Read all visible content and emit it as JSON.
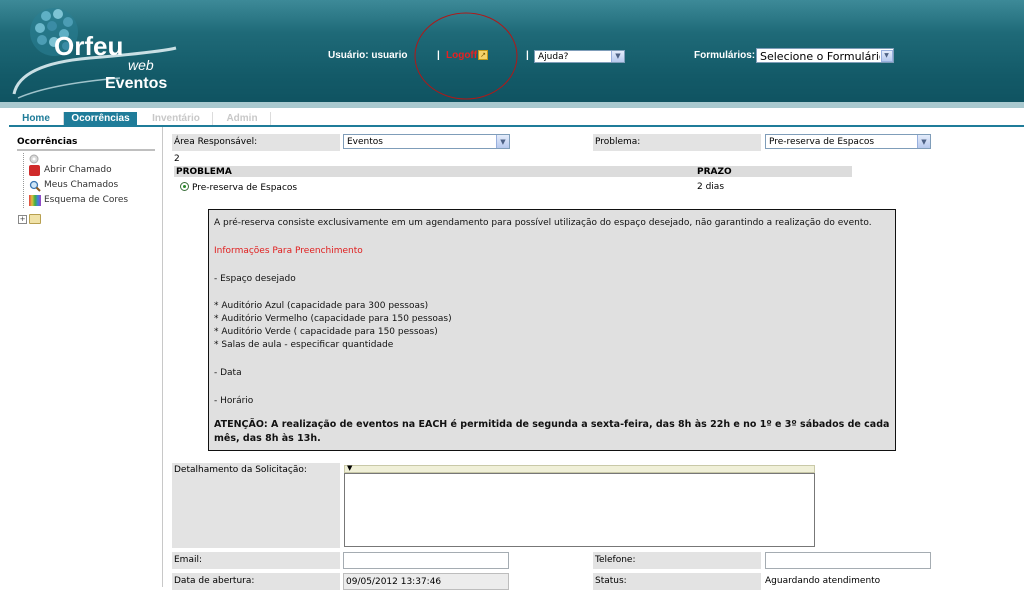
{
  "header": {
    "logo_main": "Orfeu",
    "logo_sub": "web",
    "logo_module": "Eventos",
    "user_label": "Usuário: usuario",
    "sep1": "|",
    "logoff_label": "Logoff",
    "sep2": "|",
    "help_select": "Ajuda?",
    "forms_label": "Formulários:",
    "forms_select": "Selecione o Formulário"
  },
  "tabs": [
    "Home",
    "Ocorrências",
    "Inventário",
    "Admin"
  ],
  "sidebar": {
    "title": "Ocorrências",
    "items": [
      "Abrir Chamado",
      "Meus Chamados",
      "Esquema de Cores"
    ]
  },
  "form": {
    "area_label": "Área Responsável:",
    "area_value": "Eventos",
    "problem_label": "Problema:",
    "problem_value": "Pre-reserva de Espacos",
    "count": "2",
    "col_problem": "PROBLEMA",
    "col_prazo": "PRAZO",
    "row_problem": "Pre-reserva de Espacos",
    "row_prazo": "2 dias",
    "detail_label": "Detalhamento da Solicitação:",
    "email_label": "Email:",
    "phone_label": "Telefone:",
    "opened_label": "Data de abertura:",
    "opened_value": "09/05/2012 13:37:46",
    "status_label": "Status:",
    "status_value": "Aguardando atendimento"
  },
  "description": {
    "line1": "A pré-reserva consiste exclusivamente em um agendamento para possível utilização do espaço desejado, não garantindo a realização do evento.",
    "info_title": "Informações Para Preenchimento",
    "line3": "- Espaço desejado",
    "line4": "* Auditório Azul (capacidade para 300 pessoas)",
    "line5": "* Auditório Vermelho (capacidade para 150 pessoas)",
    "line6": "* Auditório Verde ( capacidade para 150 pessoas)",
    "line7": "* Salas de aula - especificar quantidade",
    "line8": "- Data",
    "line9": "- Horário",
    "warning": "ATENÇÃO: A realização de eventos na EACH é permitida de segunda a sexta-feira, das 8h às 22h e no 1º e 3º sábados de cada mês, das 8h às 13h."
  },
  "colors": {
    "header_teal": "#135a68",
    "tab_active": "#1f7c99",
    "logoff_red": "#e82020",
    "info_red": "#e02020",
    "annotation_circle": "#b01818"
  }
}
